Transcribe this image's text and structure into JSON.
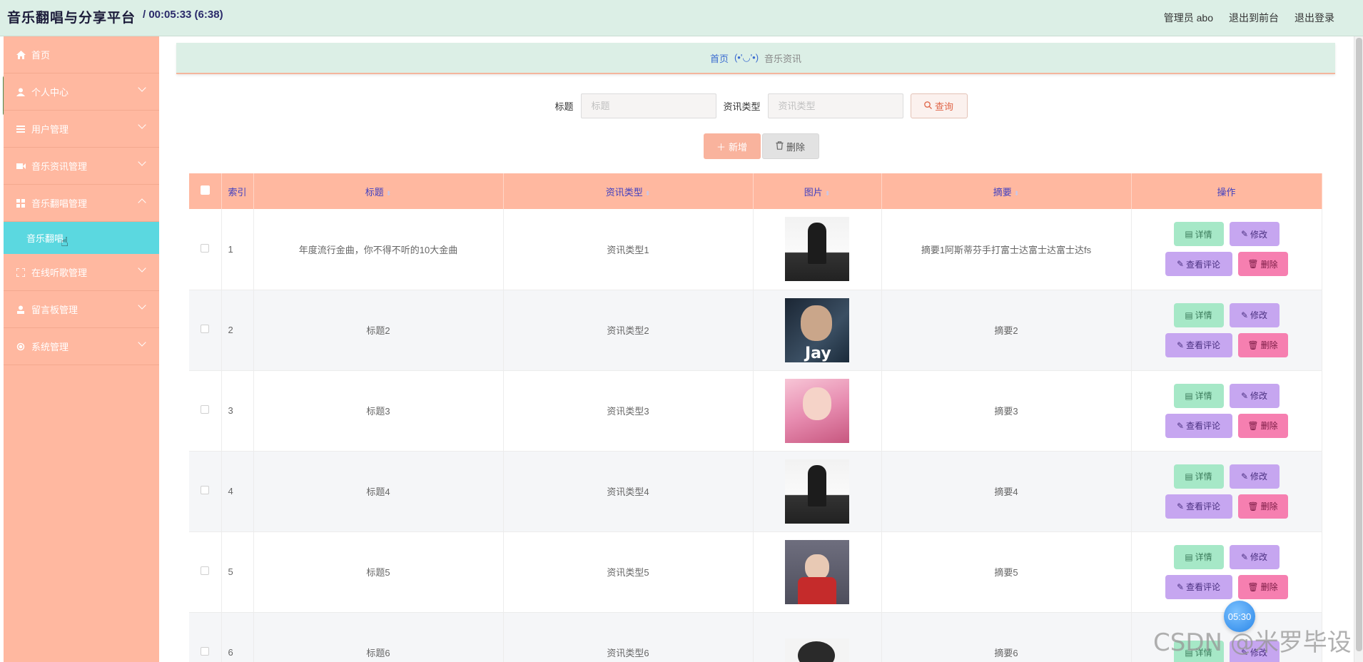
{
  "header": {
    "app_title": "音乐翻唱与分享平台",
    "timer": "/ 00:05:33 (6:38)",
    "user_label": "管理员 abo",
    "back_front": "退出到前台",
    "logout": "退出登录"
  },
  "sidebar": {
    "items": [
      {
        "label": "首页",
        "icon": "home-icon"
      },
      {
        "label": "个人中心",
        "icon": "user-icon"
      },
      {
        "label": "用户管理",
        "icon": "list-icon"
      },
      {
        "label": "音乐资讯管理",
        "icon": "video-icon"
      },
      {
        "label": "音乐翻唱管理",
        "icon": "grid-icon"
      },
      {
        "label": "在线听歌管理",
        "icon": "fullscreen-icon"
      },
      {
        "label": "留言板管理",
        "icon": "person-icon"
      },
      {
        "label": "系统管理",
        "icon": "gear-icon"
      }
    ],
    "active_sub": "音乐翻唱"
  },
  "breadcrumb": {
    "home": "首页",
    "face": "(•'◡'•)",
    "current": "音乐资讯"
  },
  "search": {
    "title_label": "标题",
    "title_placeholder": "标题",
    "type_label": "资讯类型",
    "type_placeholder": "资讯类型",
    "query_button": "查询"
  },
  "actions": {
    "add": "新增",
    "delete": "删除"
  },
  "table": {
    "headers": {
      "index": "索引",
      "title": "标题",
      "type": "资讯类型",
      "image": "图片",
      "summary": "摘要",
      "ops": "操作"
    },
    "buttons": {
      "detail": "详情",
      "edit": "修改",
      "review": "查看评论",
      "delete": "删除"
    },
    "rows": [
      {
        "index": "1",
        "title": "年度流行金曲，你不得不听的10大金曲",
        "type": "资讯类型1",
        "summary": "摘要1阿斯蒂芬手打富士达富士达富士达fs"
      },
      {
        "index": "2",
        "title": "标题2",
        "type": "资讯类型2",
        "summary": "摘要2"
      },
      {
        "index": "3",
        "title": "标题3",
        "type": "资讯类型3",
        "summary": "摘要3"
      },
      {
        "index": "4",
        "title": "标题4",
        "type": "资讯类型4",
        "summary": "摘要4"
      },
      {
        "index": "5",
        "title": "标题5",
        "type": "资讯类型5",
        "summary": "摘要5"
      },
      {
        "index": "6",
        "title": "标题6",
        "type": "资讯类型6",
        "summary": "摘要6"
      }
    ]
  },
  "overlay": {
    "bubble": "05:30",
    "watermark": "CSDN @米罗毕设"
  },
  "colors": {
    "sidebar": "#ffb8a0",
    "active_sub": "#5bd8e0",
    "header": "#dcefe6",
    "detail": "#a6e8c7",
    "edit": "#c6a6f0",
    "delete": "#f67fb0"
  }
}
